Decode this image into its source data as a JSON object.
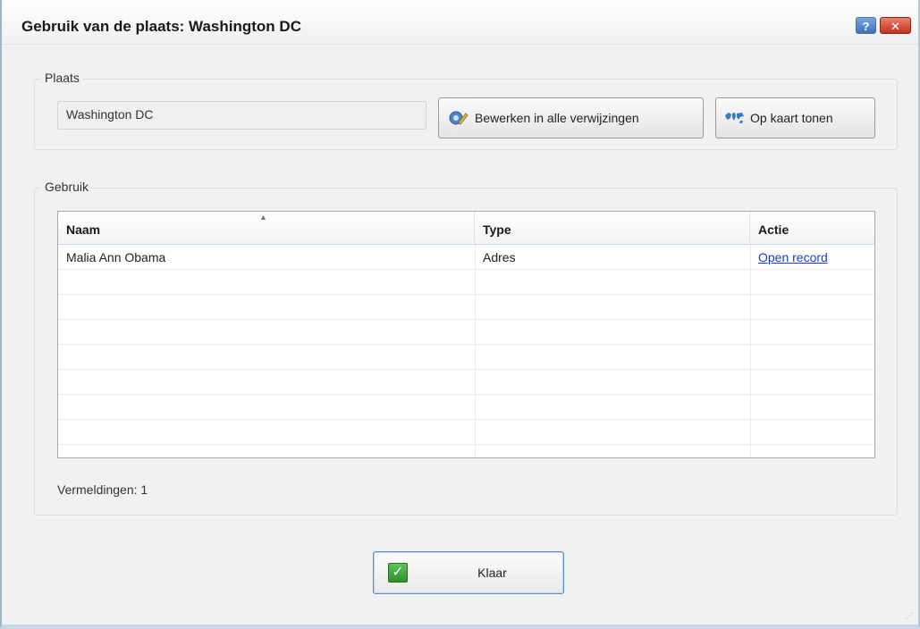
{
  "window": {
    "title": "Gebruik van de plaats: Washington DC",
    "help_label": "?",
    "close_label": "✕"
  },
  "place_group": {
    "label": "Plaats",
    "value": "Washington DC",
    "edit_button": "Bewerken in alle verwijzingen",
    "map_button": "Op kaart tonen"
  },
  "usage_group": {
    "label": "Gebruik",
    "columns": [
      "Naam",
      "Type",
      "Actie"
    ],
    "rows": [
      {
        "name": "Malia Ann Obama",
        "type": "Adres",
        "action": "Open record"
      }
    ],
    "count_text": "Vermeldingen: 1"
  },
  "footer": {
    "done_button": "Klaar"
  },
  "colors": {
    "link": "#1a3fd0",
    "check_green": "#2d8f2a",
    "accent_border": "#5d8fc7"
  }
}
